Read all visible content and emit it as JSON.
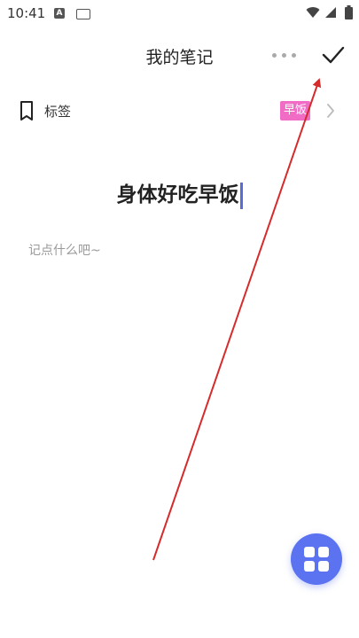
{
  "status_bar": {
    "time": "10:41",
    "icons": [
      "a-notification-icon",
      "keyboard-icon",
      "wifi-icon",
      "signal-icon",
      "battery-icon"
    ],
    "a_icon_text": "A"
  },
  "header": {
    "title": "我的笔记",
    "more_icon": "more-dots-icon",
    "confirm_icon": "check-icon"
  },
  "tag_row": {
    "label": "标签",
    "selected_tag": "早饭",
    "tag_color": "#f06cc5",
    "icon": "bookmark-icon"
  },
  "note": {
    "title": "身体好吃早饭",
    "body_value": "",
    "body_placeholder": "记点什么吧~"
  },
  "fab": {
    "icon": "grid-icon",
    "color": "#5b73f0"
  },
  "annotation": {
    "type": "arrow",
    "color": "#d62b2b",
    "points_to": "confirm-button"
  }
}
